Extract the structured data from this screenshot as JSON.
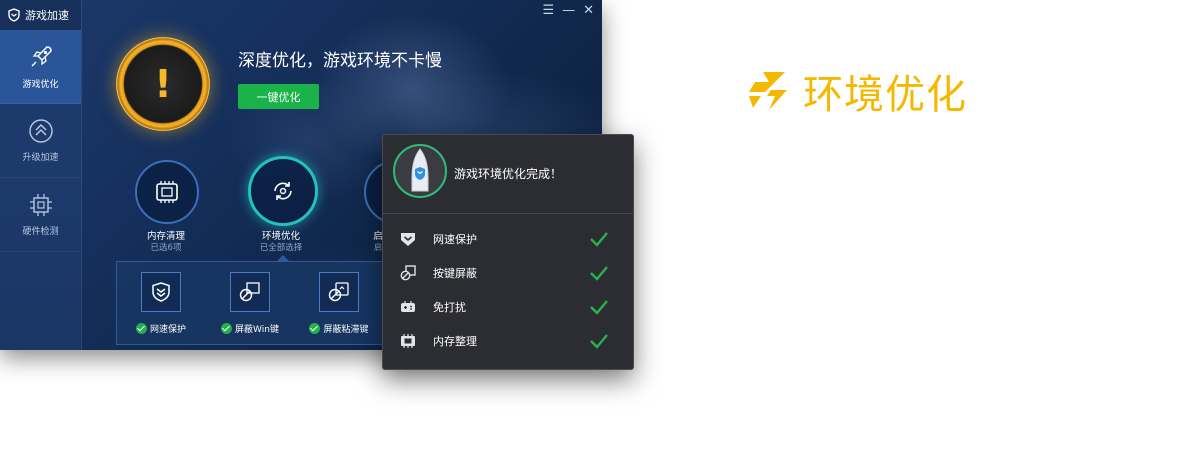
{
  "app": {
    "title": "游戏加速",
    "window_controls": [
      "☰",
      "—",
      "✕"
    ],
    "nav": [
      {
        "label": "游戏优化",
        "icon": "rocket-icon",
        "active": true
      },
      {
        "label": "升级加速",
        "icon": "double-chevron-up-icon",
        "active": false
      },
      {
        "label": "硬件检测",
        "icon": "chip-icon",
        "active": false
      }
    ]
  },
  "hero": {
    "headline": "深度优化，游戏环境不卡慢",
    "button": "一键优化",
    "warning_glyph": "!"
  },
  "functions": [
    {
      "label": "内存清理",
      "sub": "已选6项",
      "icon": "memory-icon"
    },
    {
      "label": "环境优化",
      "sub": "已全部选择",
      "icon": "refresh-icon"
    },
    {
      "label": "启",
      "sub": "启",
      "icon": "startup-icon"
    }
  ],
  "details": [
    {
      "label": "网速保护",
      "icon": "shield-chevron-icon"
    },
    {
      "label": "屏蔽Win键",
      "icon": "win-key-block-icon"
    },
    {
      "label": "屏蔽粘滞键",
      "icon": "sticky-key-block-icon"
    }
  ],
  "popup": {
    "title": "游戏环境优化完成！",
    "items": [
      {
        "label": "网速保护",
        "icon": "shield-chevron-icon"
      },
      {
        "label": "按键屏蔽",
        "icon": "key-block-icon"
      },
      {
        "label": "免打扰",
        "icon": "gamepad-icon"
      },
      {
        "label": "内存整理",
        "icon": "memory-icon"
      }
    ]
  },
  "brand": {
    "text": "环境优化",
    "icon": "brand-logo-icon",
    "color": "#f5b800"
  },
  "colors": {
    "accent_green": "#19b34a",
    "warning_orange": "#f6b92b",
    "teal_ring": "#22c3b8"
  }
}
